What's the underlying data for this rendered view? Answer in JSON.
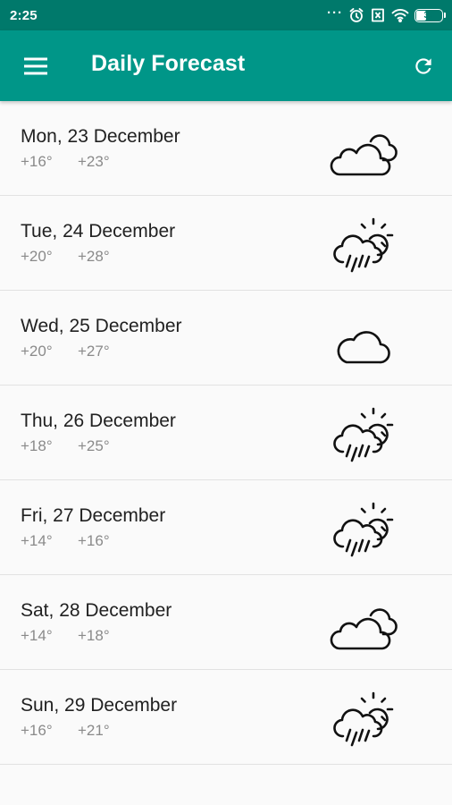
{
  "status_bar": {
    "time": "2:25",
    "battery_level": "39",
    "icons": [
      "more-dots-icon",
      "alarm-icon",
      "no-sim-icon",
      "wifi-icon",
      "battery-icon"
    ]
  },
  "app_bar": {
    "title": "Daily Forecast",
    "menu_icon": "hamburger-menu-icon",
    "refresh_icon": "refresh-icon",
    "color": "#009688",
    "status_color": "#00796b"
  },
  "forecast": [
    {
      "date": "Mon, 23 December",
      "min": "+16°",
      "max": "+23°",
      "icon": "partly-cloudy"
    },
    {
      "date": "Tue, 24 December",
      "min": "+20°",
      "max": "+28°",
      "icon": "sun-rain"
    },
    {
      "date": "Wed, 25 December",
      "min": "+20°",
      "max": "+27°",
      "icon": "cloud"
    },
    {
      "date": "Thu, 26 December",
      "min": "+18°",
      "max": "+25°",
      "icon": "sun-rain"
    },
    {
      "date": "Fri, 27 December",
      "min": "+14°",
      "max": "+16°",
      "icon": "sun-rain"
    },
    {
      "date": "Sat, 28 December",
      "min": "+14°",
      "max": "+18°",
      "icon": "partly-cloudy"
    },
    {
      "date": "Sun, 29 December",
      "min": "+16°",
      "max": "+21°",
      "icon": "sun-rain"
    }
  ]
}
